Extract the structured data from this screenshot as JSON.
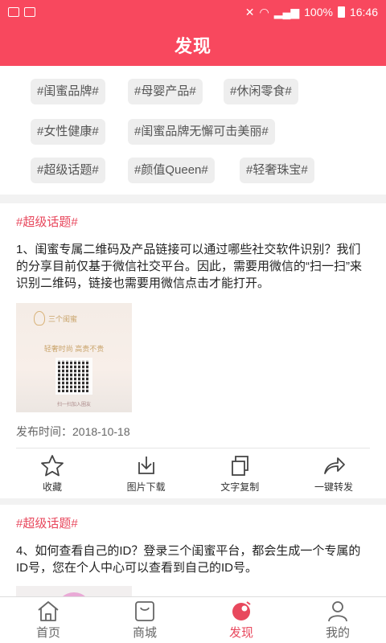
{
  "status": {
    "battery": "100%",
    "time": "16:46"
  },
  "header": {
    "title": "发现"
  },
  "tags": [
    "#闺蜜品牌#",
    "#母婴产品#",
    "#休闲零食#",
    "#女性健康#",
    "#闺蜜品牌无懈可击美丽#",
    "#超级话题#",
    "#颜值Queen#",
    "#轻奢珠宝#"
  ],
  "cards": [
    {
      "topic": "#超级话题#",
      "text": "1、闺蜜专属二维码及产品链接可以通过哪些社交软件识别？我们的分享目前仅基于微信社交平台。因此，需要用微信的“扫一扫”来识别二维码，链接也需要用微信点击才能打开。",
      "image": {
        "brand": "三个闺蜜",
        "slogan": "轻奢时尚  高贵不贵",
        "caption": "扫一扫加入圈友"
      },
      "date": "发布时间：2018-10-18",
      "actions": {
        "favorite": "收藏",
        "download": "图片下载",
        "copy": "文字复制",
        "share": "一键转发"
      }
    },
    {
      "topic": "#超级话题#",
      "text": "4、如何查看自己的ID？登录三个闺蜜平台，都会生成一个专属的ID号，您在个人中心可以查看到自己的ID号。"
    }
  ],
  "tabbar": {
    "home": "首页",
    "mall": "商城",
    "discover": "发现",
    "mine": "我的"
  },
  "colors": {
    "accent": "#f8485e",
    "topic": "#e8485d"
  }
}
